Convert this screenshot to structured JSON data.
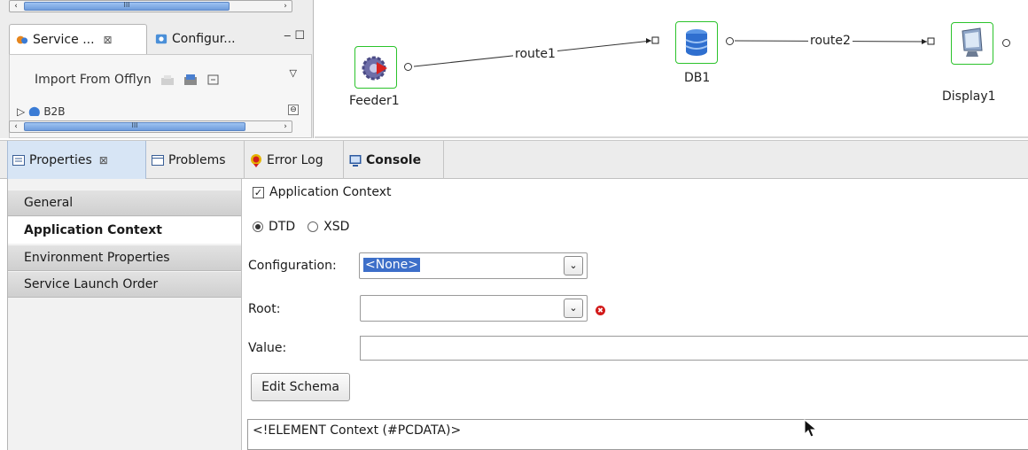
{
  "left_view": {
    "tabs": [
      {
        "label": "Service ...",
        "close": "⊠"
      },
      {
        "label": "Configur..."
      }
    ],
    "import_label": "Import From Offlyn",
    "tree_item": "B2B"
  },
  "diagram": {
    "nodes": [
      {
        "label": "Feeder1",
        "icon": "feeder-gear-icon"
      },
      {
        "label": "DB1",
        "icon": "database-icon"
      },
      {
        "label": "Display1",
        "icon": "monitor-icon"
      }
    ],
    "routes": [
      "route1",
      "route2"
    ]
  },
  "bottom_tabs": [
    {
      "label": "Properties",
      "close": "⊠",
      "icon": "properties-icon"
    },
    {
      "label": "Problems",
      "icon": "problems-icon"
    },
    {
      "label": "Error Log",
      "icon": "error-log-icon"
    },
    {
      "label": "Console",
      "icon": "console-icon"
    }
  ],
  "sidebar": {
    "items": [
      "General",
      "Application Context",
      "Environment Properties",
      "Service Launch Order"
    ],
    "selected": "Application Context"
  },
  "form": {
    "app_context_label": "Application Context",
    "app_context_checked": true,
    "radio_dtd": "DTD",
    "radio_xsd": "XSD",
    "selected_radio": "DTD",
    "configuration_label": "Configuration:",
    "configuration_value": "<None>",
    "root_label": "Root:",
    "root_value": "",
    "value_label": "Value:",
    "value_value": "",
    "edit_schema_label": "Edit Schema",
    "schema_text": "<!ELEMENT Context (#PCDATA)>"
  },
  "colors": {
    "node_border": "#2bc32b",
    "tab_active": "#d7e5f5",
    "selection": "#3d6fc9",
    "error": "#d21a1a"
  }
}
